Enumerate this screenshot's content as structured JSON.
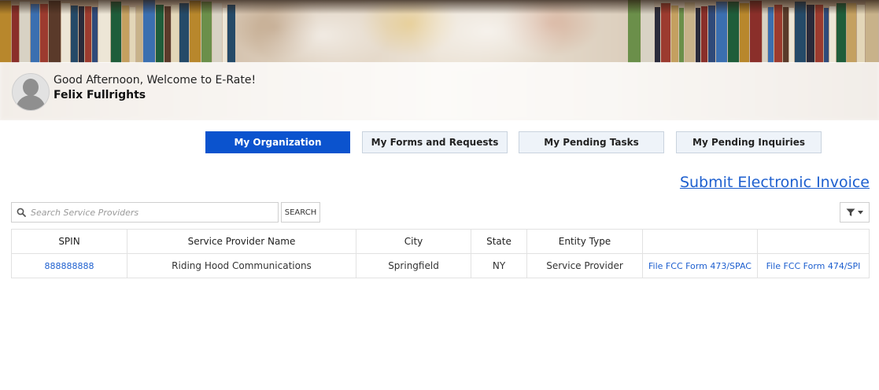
{
  "header": {
    "greeting": "Good Afternoon, Welcome to E-Rate!",
    "user_name": "Felix Fullrights"
  },
  "tabs": [
    {
      "label": "My Organization",
      "active": true
    },
    {
      "label": "My Forms and Requests",
      "active": false
    },
    {
      "label": "My Pending Tasks",
      "active": false
    },
    {
      "label": "My Pending Inquiries",
      "active": false
    }
  ],
  "invoice_link": "Submit Electronic Invoice",
  "search": {
    "placeholder": "Search Service Providers",
    "button_label": "SEARCH",
    "icon": "search-icon",
    "filter_icon": "filter-icon"
  },
  "table": {
    "columns": [
      "SPIN",
      "Service Provider Name",
      "City",
      "State",
      "Entity Type",
      "",
      ""
    ],
    "rows": [
      {
        "spin": "888888888",
        "name": "Riding Hood Communications",
        "city": "Springfield",
        "state": "NY",
        "entity_type": "Service Provider",
        "action_473": "File FCC Form 473/SPAC",
        "action_474": "File FCC Form 474/SPI"
      }
    ]
  },
  "colors": {
    "accent": "#0b53ce",
    "link": "#1d5fcf",
    "tab_inactive_bg": "#eef3f9"
  }
}
